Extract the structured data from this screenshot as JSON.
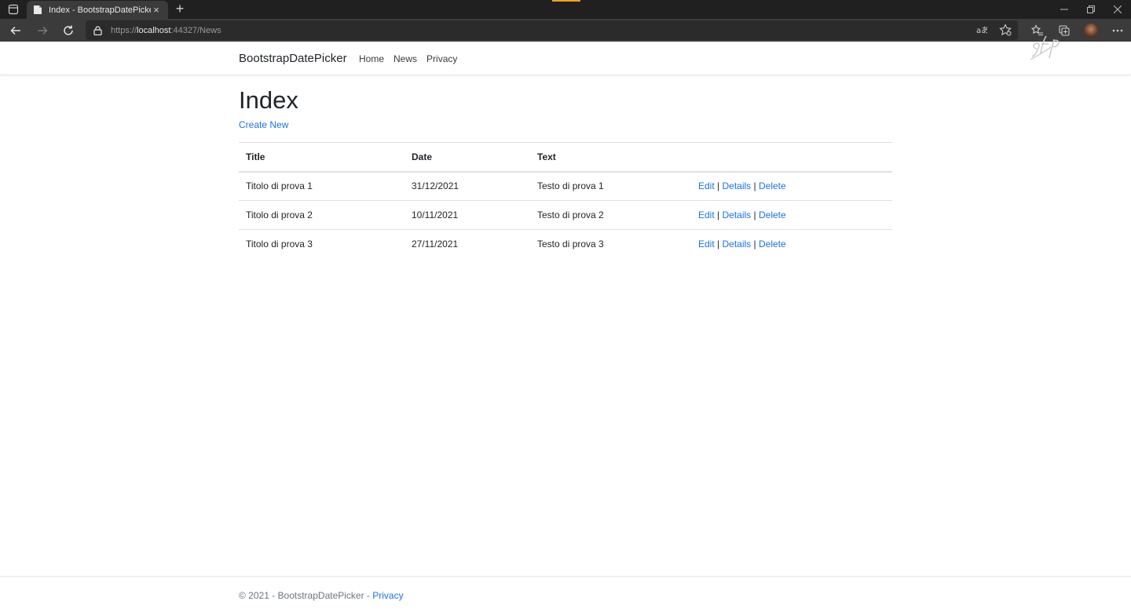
{
  "browser": {
    "tab_title": "Index - BootstrapDatePicker",
    "tab_close": "×",
    "new_tab": "+",
    "url_scheme": "https://",
    "url_host": "localhost",
    "url_rest": ":44327/News"
  },
  "navbar": {
    "brand": "BootstrapDatePicker",
    "links": [
      "Home",
      "News",
      "Privacy"
    ]
  },
  "page": {
    "title": "Index",
    "create_new": "Create New"
  },
  "table": {
    "headers": [
      "Title",
      "Date",
      "Text",
      ""
    ],
    "rows": [
      {
        "title": "Titolo di prova 1",
        "date": "31/12/2021",
        "text": "Testo di prova 1"
      },
      {
        "title": "Titolo di prova 2",
        "date": "10/11/2021",
        "text": "Testo di prova 2"
      },
      {
        "title": "Titolo di prova 3",
        "date": "27/11/2021",
        "text": "Testo di prova 3"
      }
    ],
    "actions": {
      "edit": "Edit",
      "details": "Details",
      "delete": "Delete",
      "separator": "|"
    }
  },
  "footer": {
    "text": "© 2021 - BootstrapDatePicker - ",
    "privacy": "Privacy"
  },
  "colors": {
    "link": "#1a73e8",
    "chrome_dark": "#202020",
    "chrome_toolbar": "#3b3b3b"
  },
  "icons": [
    "tab-actions-icon",
    "page-favicon-icon",
    "back-icon",
    "forward-icon",
    "refresh-icon",
    "lock-icon",
    "read-aloud-icon",
    "add-favorite-icon",
    "favorites-icon",
    "collections-icon",
    "profile-avatar",
    "more-icon",
    "watermark-logo"
  ]
}
